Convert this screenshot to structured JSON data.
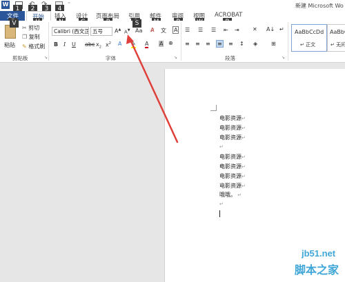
{
  "title_bar": {
    "title": "新建 Microsoft Wo"
  },
  "qat_keytips": [
    "1",
    "2",
    "3",
    "4"
  ],
  "tabs": [
    {
      "label": "文件",
      "keytip": "F"
    },
    {
      "label": "开始",
      "keytip": "H"
    },
    {
      "label": "插入",
      "keytip": "N"
    },
    {
      "label": "设计",
      "keytip": "G"
    },
    {
      "label": "页面布局",
      "keytip": "P"
    },
    {
      "label": "引用",
      "keytip": "S"
    },
    {
      "label": "邮件",
      "keytip": "M"
    },
    {
      "label": "审阅",
      "keytip": "R"
    },
    {
      "label": "视图",
      "keytip": "W"
    },
    {
      "label": "ACROBAT",
      "keytip": "B"
    }
  ],
  "clipboard": {
    "paste": "粘贴",
    "cut": "剪切",
    "copy": "复制",
    "format_painter": "格式刷",
    "group": "剪贴板"
  },
  "font": {
    "font_name": "Calibri (西文正",
    "font_size": "五号",
    "change_case": "Aa",
    "group": "字体"
  },
  "paragraph": {
    "group": "段落"
  },
  "styles": [
    {
      "preview": "AaBbCcDd",
      "name": "↵ 正文"
    },
    {
      "preview": "AaBbCcD",
      "name": "↵ 无间"
    }
  ],
  "document": {
    "lines": [
      "电影资源",
      "电影资源",
      "电影资源",
      "",
      "电影资源",
      "",
      "电影资源",
      "电影资源",
      "电影资源",
      "",
      "哦哦。",
      ""
    ]
  },
  "watermark": {
    "domain": "jb51.net",
    "site": "脚本之家"
  },
  "colors": {
    "accent": "#2b579a",
    "arrow": "#e0403a",
    "keytip_bg": "#3a3a3a"
  }
}
